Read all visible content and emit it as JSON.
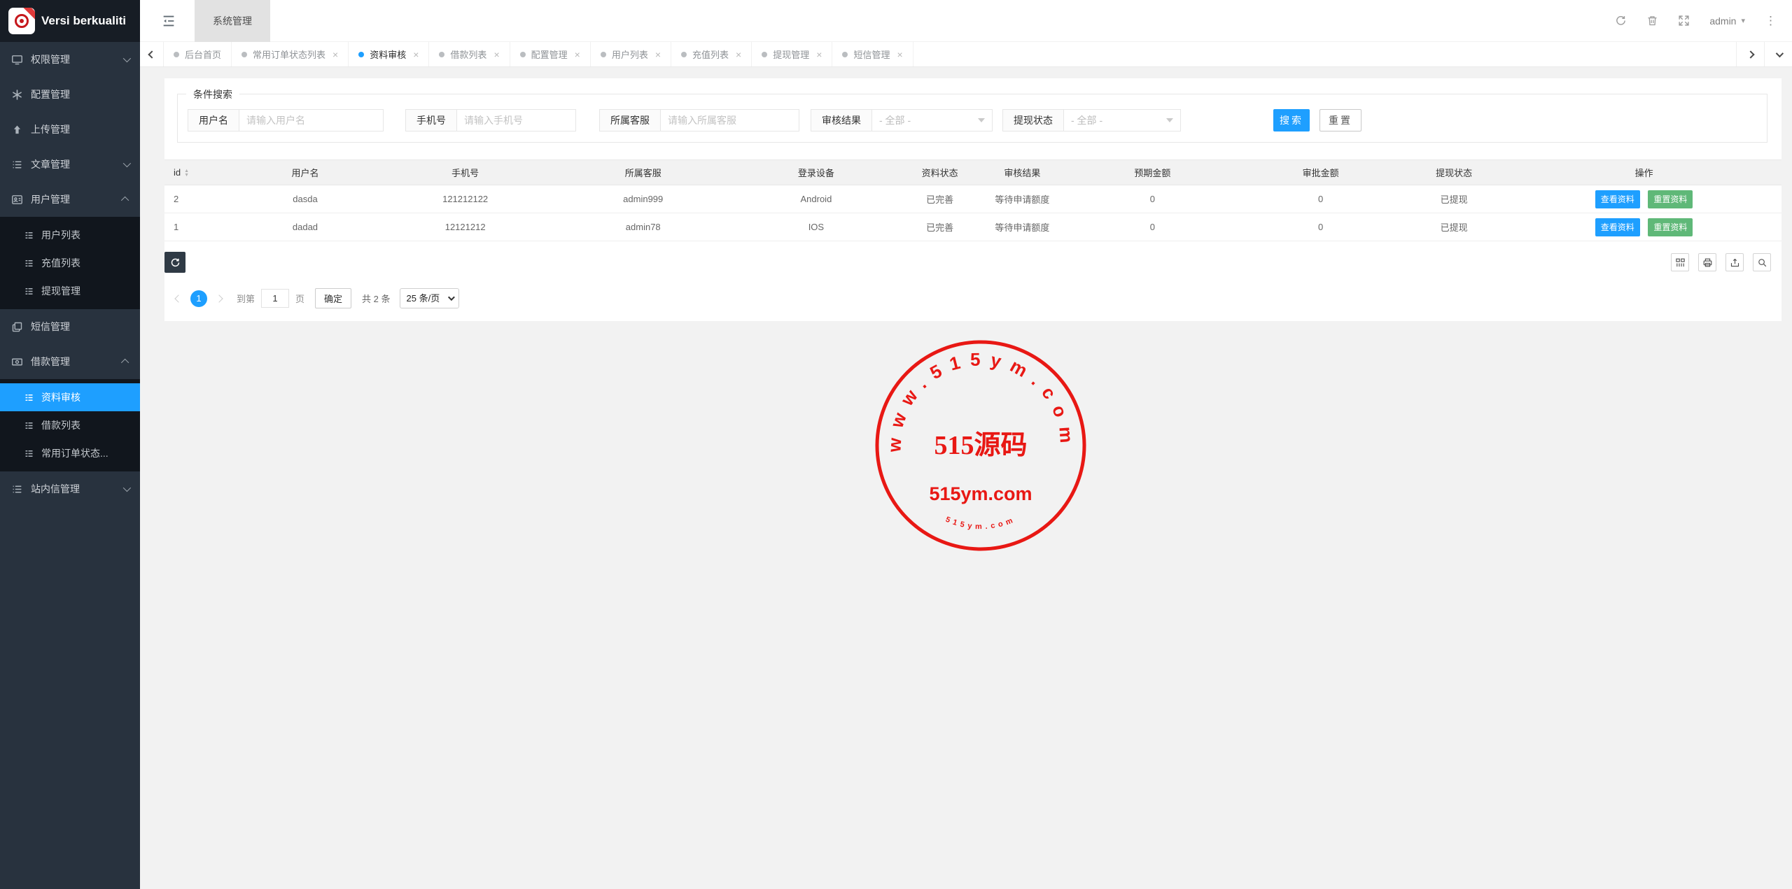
{
  "sidebar": {
    "logo_text": "Versi berkualiti",
    "items": [
      {
        "label": "权限管理"
      },
      {
        "label": "配置管理"
      },
      {
        "label": "上传管理"
      },
      {
        "label": "文章管理"
      },
      {
        "label": "用户管理",
        "children": [
          {
            "label": "用户列表"
          },
          {
            "label": "充值列表"
          },
          {
            "label": "提现管理"
          }
        ]
      },
      {
        "label": "短信管理"
      },
      {
        "label": "借款管理",
        "children": [
          {
            "label": "资料审核"
          },
          {
            "label": "借款列表"
          },
          {
            "label": "常用订单状态..."
          }
        ]
      },
      {
        "label": "站内信管理"
      }
    ]
  },
  "topbar": {
    "module_tab": "系统管理",
    "username": "admin"
  },
  "tabbar": {
    "tabs": [
      {
        "label": "后台首页"
      },
      {
        "label": "常用订单状态列表"
      },
      {
        "label": "资料审核"
      },
      {
        "label": "借款列表"
      },
      {
        "label": "配置管理"
      },
      {
        "label": "用户列表"
      },
      {
        "label": "充值列表"
      },
      {
        "label": "提现管理"
      },
      {
        "label": "短信管理"
      }
    ]
  },
  "search_form": {
    "legend": "条件搜索",
    "fields": [
      {
        "label": "用户名",
        "placeholder": "请输入用户名"
      },
      {
        "label": "手机号",
        "placeholder": "请输入手机号"
      },
      {
        "label": "所属客服",
        "placeholder": "请输入所属客服"
      },
      {
        "label": "审核结果",
        "value": "- 全部 -"
      },
      {
        "label": "提现状态",
        "value": "- 全部 -"
      }
    ],
    "search_label": "搜索",
    "reset_label": "重置"
  },
  "table": {
    "headers": [
      "id",
      "用户名",
      "手机号",
      "所属客服",
      "登录设备",
      "资料状态",
      "审核结果",
      "预期金额",
      "审批金额",
      "提现状态",
      "操作"
    ],
    "rows": [
      {
        "id": "2",
        "username": "dasda",
        "phone": "121212122",
        "service": "admin999",
        "device": "Android",
        "profile_status": "已完善",
        "audit_result": "等待申请额度",
        "expected_amount": "0",
        "approved_amount": "0",
        "withdraw_status": "已提现"
      },
      {
        "id": "1",
        "username": "dadad",
        "phone": "12121212",
        "service": "admin78",
        "device": "IOS",
        "profile_status": "已完善",
        "audit_result": "等待申请额度",
        "expected_amount": "0",
        "approved_amount": "0",
        "withdraw_status": "已提现"
      }
    ],
    "view_label": "查看资料",
    "reset_label": "重置资料"
  },
  "pagination": {
    "current_page": "1",
    "goto_prefix": "到第",
    "goto_value": "1",
    "goto_suffix": "页",
    "confirm_label": "确定",
    "total_text": "共 2 条",
    "page_size": "25 条/页"
  },
  "watermark": {
    "arc_text": "www.515ym.com",
    "title": "515源码",
    "subtitle": "515ym.com",
    "bottom_text": "515ym.com",
    "color": "#e8100c"
  },
  "icons": {
    "close": "×",
    "kebab": "⋮",
    "caret_down": "▾",
    "sort_asc": "▲",
    "sort_desc": "▼"
  },
  "colors": {
    "primary": "#1e9fff",
    "green": "#5fb878",
    "sidebar": "#28323e",
    "stamp_red": "#e8100c"
  }
}
